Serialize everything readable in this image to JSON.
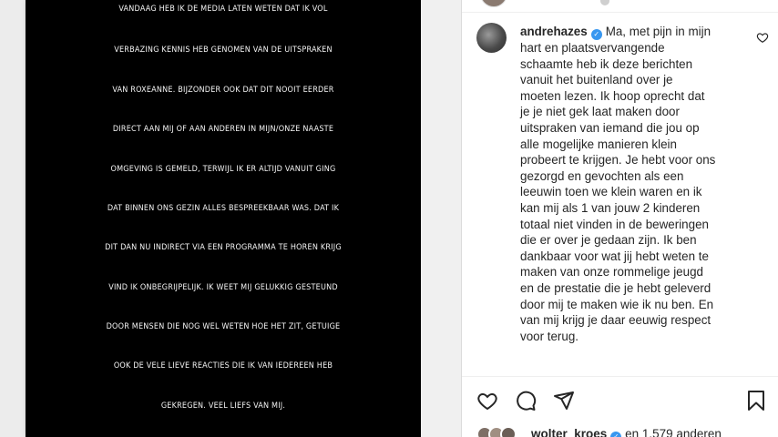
{
  "media": {
    "lines": [
      "VANDAAG HEB IK DE MEDIA LATEN WETEN DAT IK VOL",
      "VERBAZING KENNIS HEB GENOMEN VAN DE UITSPRAKEN",
      "VAN ROXEANNE. BIJZONDER OOK DAT DIT NOOIT EERDER",
      "DIRECT AAN MIJ  OF AAN ANDEREN IN MIJN/ONZE NAASTE",
      "OMGEVING IS GEMELD, TERWIJL IK ER ALTIJD VANUIT GING",
      "DAT BINNEN ONS GEZIN ALLES BESPREEKBAAR WAS. DAT IK",
      "DIT DAN NU INDIRECT VIA EEN PROGRAMMA TE HOREN KRIJG",
      "VIND IK ONBEGRIJPELIJK. IK WEET MIJ GELUKKIG GESTEUND",
      "DOOR MENSEN DIE NOG WEL WETEN HOE HET ZIT, GETUIGE",
      "OOK DE VELE LIEVE REACTIES DIE IK VAN IEDEREEN HEB",
      "GEKREGEN. VEEL LIEFS VAN MIJ."
    ]
  },
  "comment": {
    "username": "andrehazes",
    "verified_icon": "verified-badge-icon",
    "lines": [
      "Ma, met pijn in mijn",
      "hart en plaatsvervangende",
      "schaamte heb ik deze berichten",
      "vanuit het buitenland over je",
      "moeten lezen. Ik hoop oprecht dat",
      "je je niet gek laat maken door",
      "uitspraken van iemand die jou op",
      "alle mogelijke manieren klein",
      "probeert te krijgen. Je hebt voor ons",
      "gezorgd en gevochten als een",
      "leeuwin toen we klein waren en ik",
      "kan mij als 1 van jouw 2 kinderen",
      "totaal niet vinden in de beweringen",
      "die er over je gedaan zijn. Ik ben",
      "dankbaar voor wat jij hebt weten te",
      "maken van onze rommelige jeugd",
      "en de prestatie die je hebt geleverd",
      "door mij te maken wie ik nu ben. En",
      "van mij krijg je daar eeuwig respect",
      "voor terug."
    ]
  },
  "likes": {
    "first_user": "wolter_kroes",
    "rest": "en 1.579 anderen"
  },
  "colors": {
    "verified": "#3897f0",
    "text": "#262626",
    "media_bg": "#000000"
  }
}
